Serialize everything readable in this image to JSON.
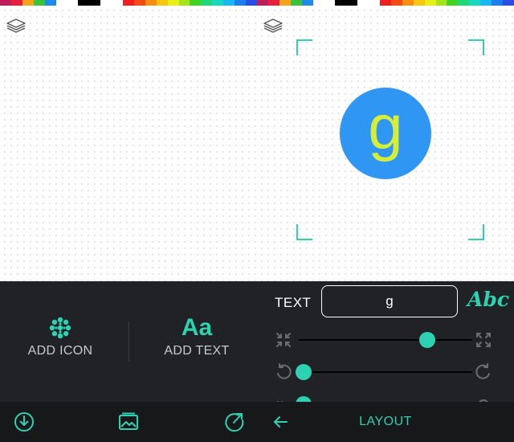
{
  "palette": {
    "left_strip": [
      "#c01c5a",
      "#e81f3b",
      "#f7a21c",
      "#3ac23a",
      "#1f8ae8",
      "#ffffff",
      "#ffffff",
      "#000000",
      "#000000",
      "#ffffff",
      "#ffffff",
      "#f21d1d",
      "#f54b12",
      "#f98e0f",
      "#f9c611",
      "#e8ef13",
      "#a6e41a",
      "#43d321",
      "#22d67a",
      "#15d9c0",
      "#1ab8f0",
      "#1c7ff0",
      "#2a4fe8"
    ],
    "right_strip": [
      "#c01c5a",
      "#e81f3b",
      "#f7a21c",
      "#3ac23a",
      "#1f8ae8",
      "#ffffff",
      "#ffffff",
      "#000000",
      "#000000",
      "#ffffff",
      "#ffffff",
      "#f21d1d",
      "#f54b12",
      "#f98e0f",
      "#f9c611",
      "#e8ef13",
      "#a6e41a",
      "#43d321",
      "#22d67a",
      "#15d9c0",
      "#1ab8f0",
      "#1c7ff0",
      "#2a4fe8"
    ]
  },
  "colors": {
    "accent": "#2fd1b3",
    "logo_bg": "#2f97f3",
    "logo_fg": "#d7ee37",
    "panel_bg": "#202225",
    "nav_bg": "#17181a"
  },
  "left": {
    "layers_icon": "layers-icon",
    "tools": {
      "add_icon_label": "ADD ICON",
      "add_text_glyph": "Aa",
      "add_text_label": "ADD TEXT"
    },
    "nav": {
      "download_icon": "download-icon",
      "image_icon": "image-icon",
      "share_icon": "share-icon"
    }
  },
  "right": {
    "layers_icon": "layers-icon",
    "logo_letter": "g",
    "text_label": "TEXT",
    "text_value": "g",
    "font_button": "Abc",
    "sliders": {
      "size": 0.74,
      "rotation": 0.03,
      "third": 0.03
    },
    "nav_title": "LAYOUT"
  }
}
